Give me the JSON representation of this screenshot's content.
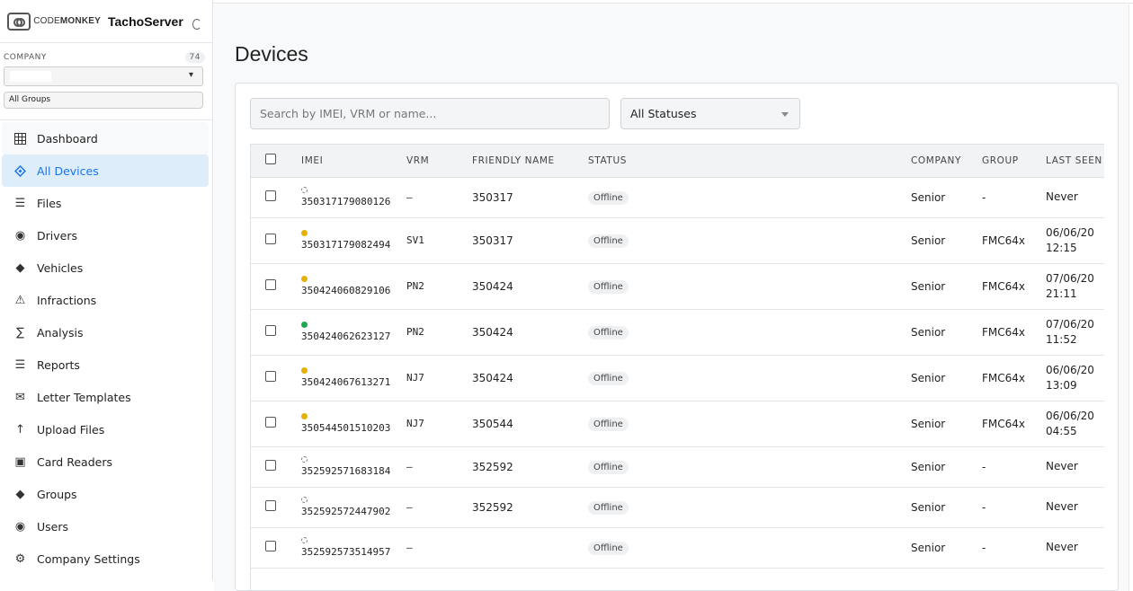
{
  "brand": {
    "logo_text_light": "CODE",
    "logo_text_bold": "MONKEY",
    "app_title": "TachoServer"
  },
  "sidebar": {
    "company_label": "COMPANY",
    "company_count": "74",
    "company_value": "",
    "group_value": "All Groups",
    "items": [
      {
        "label": "Dashboard",
        "icon": "grid-icon"
      },
      {
        "label": "All Devices",
        "icon": "diamond-outline-icon"
      },
      {
        "label": "Files",
        "icon": "list-icon"
      },
      {
        "label": "Drivers",
        "icon": "record-icon"
      },
      {
        "label": "Vehicles",
        "icon": "diamond-icon"
      },
      {
        "label": "Infractions",
        "icon": "warning-icon"
      },
      {
        "label": "Analysis",
        "icon": "sigma-icon"
      },
      {
        "label": "Reports",
        "icon": "list-icon"
      },
      {
        "label": "Letter Templates",
        "icon": "mail-icon"
      },
      {
        "label": "Upload Files",
        "icon": "arrow-up-icon"
      },
      {
        "label": "Card Readers",
        "icon": "square-icon"
      },
      {
        "label": "Groups",
        "icon": "diamond-icon"
      },
      {
        "label": "Users",
        "icon": "record-icon"
      },
      {
        "label": "Company Settings",
        "icon": "gear-icon"
      }
    ]
  },
  "main": {
    "title": "Devices",
    "search_placeholder": "Search by IMEI, VRM or name...",
    "status_filter": "All Statuses",
    "columns": [
      "IMEI",
      "VRM",
      "FRIENDLY NAME",
      "STATUS",
      "COMPANY",
      "GROUP",
      "LAST SEEN"
    ],
    "rows": [
      {
        "dot": "none",
        "imei": "350317179080126",
        "vrm": "–",
        "name": "350317",
        "status": "Offline",
        "company": "Senior",
        "group": "-",
        "last1": "Never",
        "last2": ""
      },
      {
        "dot": "yellow",
        "imei": "350317179082494",
        "vrm": "SV1",
        "name": "350317",
        "status": "Offline",
        "company": "Senior",
        "group": "FMC64x",
        "last1": "06/06/20",
        "last2": "12:15"
      },
      {
        "dot": "yellow",
        "imei": "350424060829106",
        "vrm": "PN2",
        "name": "350424",
        "status": "Offline",
        "company": "Senior",
        "group": "FMC64x",
        "last1": "07/06/20",
        "last2": "21:11"
      },
      {
        "dot": "green",
        "imei": "350424062623127",
        "vrm": "PN2",
        "name": "350424",
        "status": "Offline",
        "company": "Senior",
        "group": "FMC64x",
        "last1": "07/06/20",
        "last2": "11:52"
      },
      {
        "dot": "yellow",
        "imei": "350424067613271",
        "vrm": "NJ7",
        "name": "350424",
        "status": "Offline",
        "company": "Senior",
        "group": "FMC64x",
        "last1": "06/06/20",
        "last2": "13:09"
      },
      {
        "dot": "yellow",
        "imei": "350544501510203",
        "vrm": "NJ7",
        "name": "350544",
        "status": "Offline",
        "company": "Senior",
        "group": "FMC64x",
        "last1": "06/06/20",
        "last2": "04:55"
      },
      {
        "dot": "none",
        "imei": "352592571683184",
        "vrm": "–",
        "name": "352592",
        "status": "Offline",
        "company": "Senior",
        "group": "-",
        "last1": "Never",
        "last2": ""
      },
      {
        "dot": "none",
        "imei": "352592572447902",
        "vrm": "–",
        "name": "352592",
        "status": "Offline",
        "company": "Senior",
        "group": "-",
        "last1": "Never",
        "last2": ""
      },
      {
        "dot": "none",
        "imei": "352592573514957",
        "vrm": "–",
        "name": "",
        "status": "Offline",
        "company": "Senior",
        "group": "-",
        "last1": "Never",
        "last2": ""
      }
    ]
  }
}
